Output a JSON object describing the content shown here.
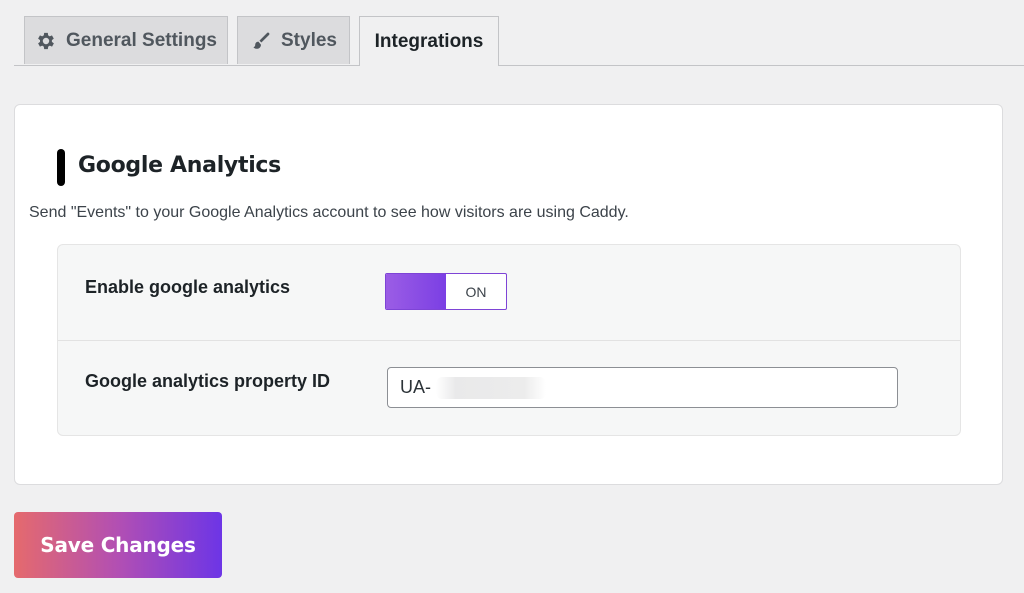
{
  "tabs": [
    {
      "label": "General Settings",
      "icon": "gear-icon"
    },
    {
      "label": "Styles",
      "icon": "paintbrush-icon"
    },
    {
      "label": "Integrations",
      "active": true
    }
  ],
  "section": {
    "title": "Google Analytics",
    "description": "Send \"Events\" to your Google Analytics account to see how visitors are using Caddy."
  },
  "settings": {
    "enable_label": "Enable google analytics",
    "toggle_state": "ON",
    "property_label": "Google analytics property ID",
    "property_value": "UA-"
  },
  "actions": {
    "save_label": "Save Changes"
  },
  "colors": {
    "accent_purple": "#7b3fe4",
    "accent_red": "#e56a6d"
  }
}
